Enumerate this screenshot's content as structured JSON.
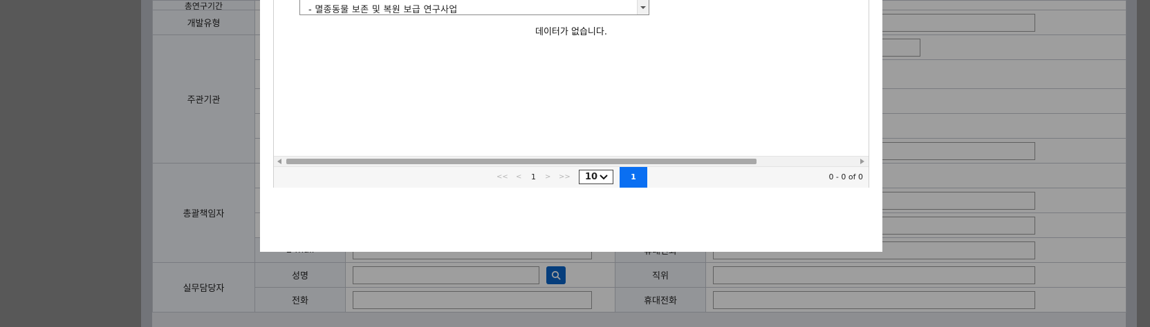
{
  "background_form": {
    "rows": {
      "period": {
        "label": "총연구기간"
      },
      "dev_type": {
        "label": "개발유형"
      },
      "host_org": {
        "label": "주관기관"
      },
      "chief": {
        "label": "총괄책임자"
      },
      "email": {
        "label": "E-mail"
      },
      "mobile_1": {
        "label": "휴대전화"
      },
      "manager": {
        "label": "실무담당자"
      },
      "name": {
        "label": "성명"
      },
      "position": {
        "label": "직위"
      },
      "phone": {
        "label": "전화"
      },
      "mobile_2": {
        "label": "휴대전화"
      }
    }
  },
  "modal": {
    "dropdown_option": "- 멸종동물 보존 및 복원 보급 연구사업",
    "empty_message": "데이터가 없습니다.",
    "pagination": {
      "first": "<<",
      "prev": "<",
      "current_page": "1",
      "next": ">",
      "last": ">>",
      "page_size": "10",
      "active_page": "1",
      "range": "0 - 0 of 0"
    }
  },
  "colors": {
    "primary_blue": "#0a6ff2",
    "search_button": "#0a64c8",
    "overlay": "rgba(0,0,0,0.38)"
  }
}
